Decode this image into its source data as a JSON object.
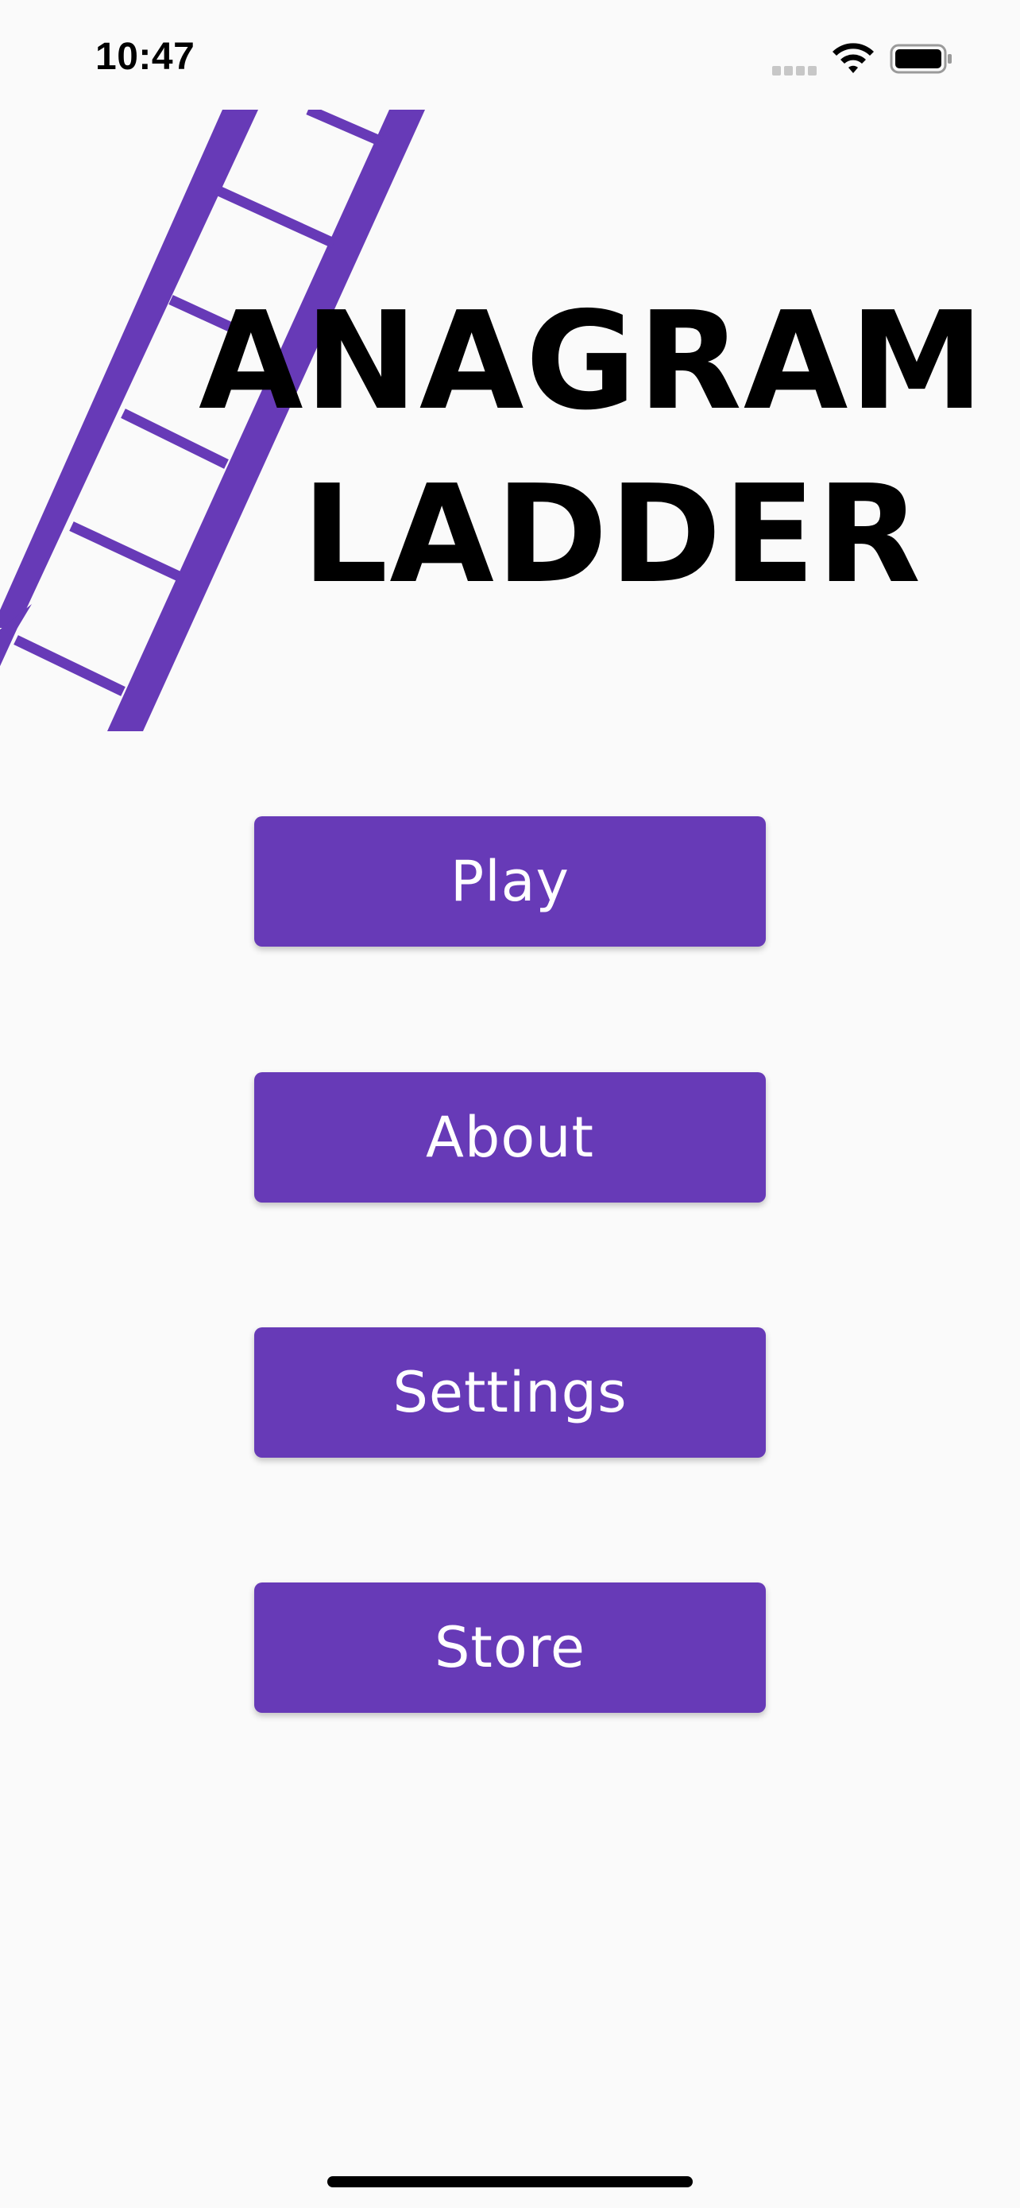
{
  "status_bar": {
    "time": "10:47"
  },
  "title": {
    "line1": "ANAGRAM",
    "line2": "LADDER"
  },
  "menu": {
    "play_label": "Play",
    "about_label": "About",
    "settings_label": "Settings",
    "store_label": "Store"
  },
  "colors": {
    "accent": "#673ab7",
    "background": "#fafafa",
    "title_text": "#000000",
    "button_text": "#ffffff"
  },
  "icons": [
    "signal-icon",
    "wifi-icon",
    "battery-icon",
    "ladder-icon"
  ]
}
